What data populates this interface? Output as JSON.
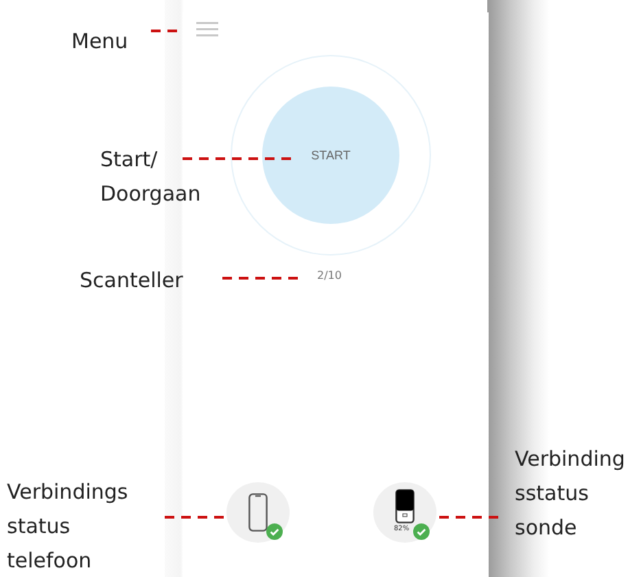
{
  "screen": {
    "start_button": {
      "label": "START"
    },
    "scan_counter": "2/10",
    "phone_status": {
      "connected": true
    },
    "probe_status": {
      "connected": true,
      "battery": "82%"
    }
  },
  "callouts": [
    {
      "kind": "menu",
      "text": "Menu"
    },
    {
      "kind": "start",
      "text": "Start/\nDoorgaan"
    },
    {
      "kind": "counter",
      "text": "Scanteller"
    },
    {
      "kind": "phone",
      "text": "Verbindings\nstatus\ntelefoon"
    },
    {
      "kind": "probe",
      "text": "Verbinding\nsstatus\nsonde"
    }
  ]
}
